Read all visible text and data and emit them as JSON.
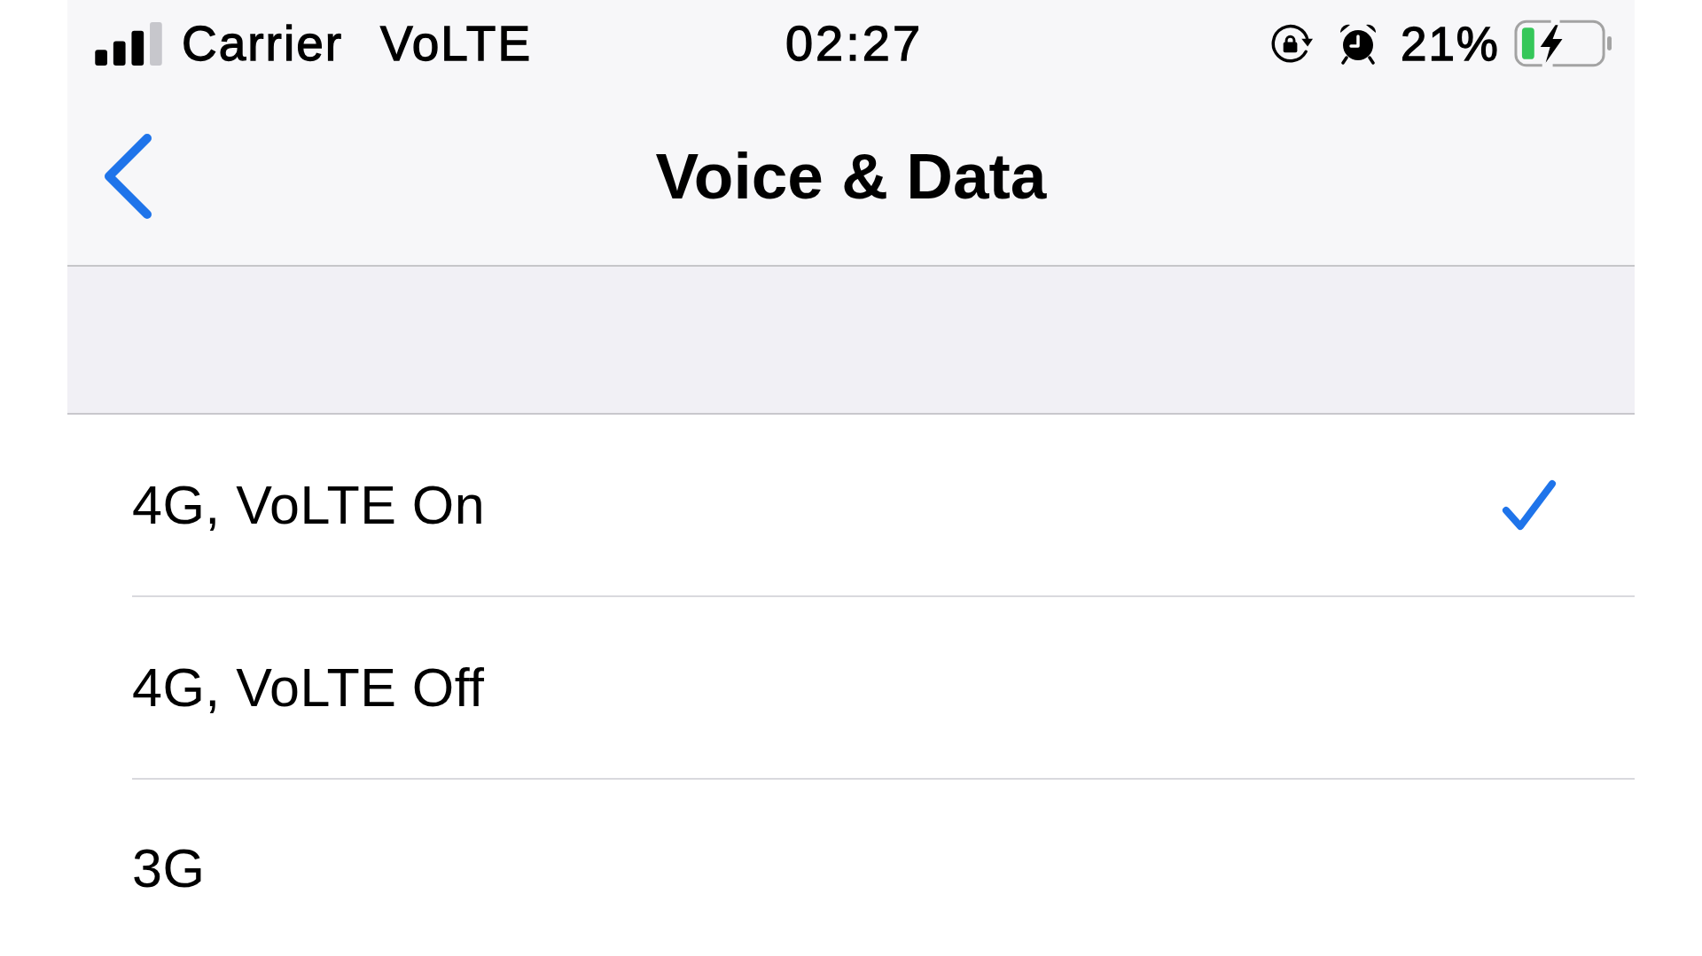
{
  "status_bar": {
    "carrier": "Carrier",
    "network": "VoLTE",
    "time": "02:27",
    "battery_percent": "21%"
  },
  "navigation_bar": {
    "title": "Voice & Data"
  },
  "options": [
    {
      "label": "4G, VoLTE On",
      "selected": true
    },
    {
      "label": "4G, VoLTE Off",
      "selected": false
    },
    {
      "label": "3G",
      "selected": false
    }
  ]
}
